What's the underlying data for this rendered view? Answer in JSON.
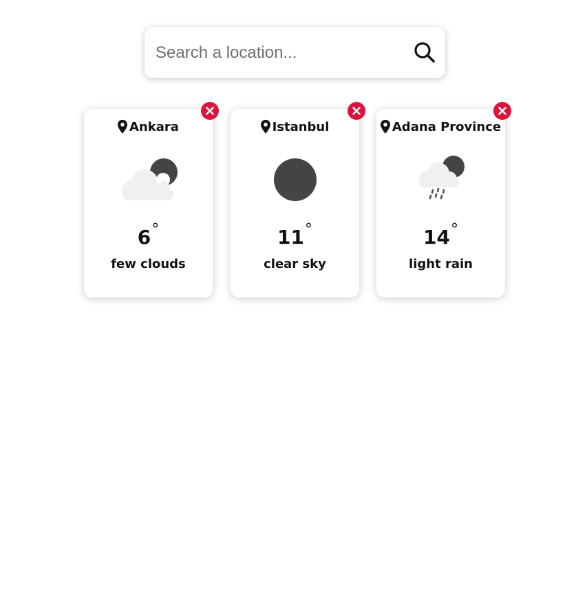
{
  "search": {
    "placeholder": "Search a location...",
    "value": "",
    "icon": "search-icon"
  },
  "cards": [
    {
      "location": "Ankara",
      "temp": "6",
      "degree": "°",
      "description": "few clouds",
      "icon": "few-clouds-night-icon"
    },
    {
      "location": "Istanbul",
      "temp": "11",
      "degree": "°",
      "description": "clear sky",
      "icon": "clear-sky-night-icon"
    },
    {
      "location": "Adana Province",
      "temp": "14",
      "degree": "°",
      "description": "light rain",
      "icon": "light-rain-night-icon"
    }
  ],
  "colors": {
    "close": "#dc143c",
    "moon": "#444444",
    "cloud": "#f0f0f0",
    "text": "#111111"
  }
}
